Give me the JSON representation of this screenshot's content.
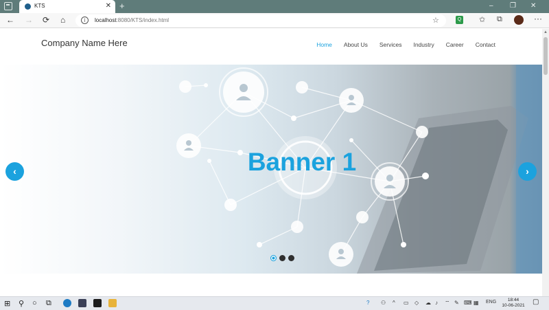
{
  "browser": {
    "tab_title": "KTS",
    "tab_close": "✕",
    "new_tab": "+",
    "url_host": "localhost",
    "url_rest": ":8080/KTS/index.html",
    "window_controls": [
      "–",
      "❐",
      "✕"
    ],
    "extension_badge": "Q"
  },
  "site": {
    "brand": "Company Name Here",
    "nav": [
      "Home",
      "About Us",
      "Services",
      "Industry",
      "Career",
      "Contact"
    ],
    "active_nav": "Home",
    "banner_title": "Banner 1",
    "slides": 3,
    "active_slide": 1,
    "accent_color": "#1ba2de"
  },
  "taskbar": {
    "language": "ENG",
    "time": "18:44",
    "date": "10-06-2021"
  },
  "icons": {
    "back": "←",
    "forward": "→",
    "refresh": "⟳",
    "home": "⌂",
    "prev": "‹",
    "next": "›"
  }
}
